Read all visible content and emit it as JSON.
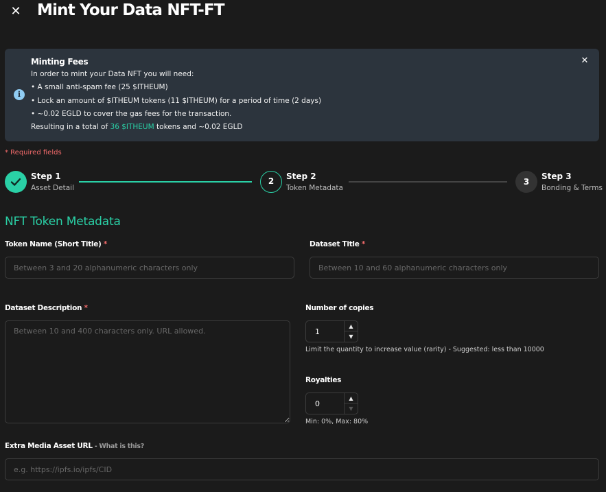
{
  "header": {
    "close_icon": "close-icon",
    "title": "Mint Your Data NFT-FT"
  },
  "alert": {
    "title": "Minting Fees",
    "lines": [
      "In order to mint your Data NFT you will need:",
      "• A small anti-spam fee (25 $ITHEUM)",
      "• Lock an amount of $ITHEUM tokens (11 $ITHEUM) for a period of time (2 days)",
      "• ~0.02 EGLD to cover the gas fees for the transaction."
    ],
    "total_prefix": "Resulting in a total of ",
    "total_amount": "36 $ITHEUM",
    "total_suffix": " tokens and ~0.02 EGLD",
    "info_icon": "info-icon",
    "close_icon": "close-icon"
  },
  "required_note": "*  Required fields",
  "stepper": {
    "steps": [
      {
        "number": "1",
        "title": "Step 1",
        "subtitle": "Asset Detail",
        "state": "complete"
      },
      {
        "number": "2",
        "title": "Step 2",
        "subtitle": "Token Metadata",
        "state": "active"
      },
      {
        "number": "3",
        "title": "Step 3",
        "subtitle": "Bonding & Terms",
        "state": "pending"
      }
    ]
  },
  "section_title": "NFT Token Metadata",
  "form": {
    "token_name": {
      "label": "Token Name (Short Title)",
      "required": "*",
      "placeholder": "Between 3 and 20 alphanumeric characters only",
      "value": ""
    },
    "dataset_title": {
      "label": "Dataset Title",
      "required": "*",
      "placeholder": "Between 10 and 60 alphanumeric characters only",
      "value": ""
    },
    "dataset_description": {
      "label": "Dataset Description",
      "required": "*",
      "placeholder": "Between 10 and 400 characters only. URL allowed.",
      "value": ""
    },
    "copies": {
      "label": "Number of copies",
      "value": "1",
      "help": "Limit the quantity to increase value (rarity) - Suggested: less than 10000"
    },
    "royalties": {
      "label": "Royalties",
      "value": "0",
      "help": "Min: 0%, Max: 80%"
    },
    "extra_media": {
      "label": "Extra Media Asset URL",
      "hint": " - What is this?",
      "placeholder": "e.g. https://ipfs.io/ipfs/CID",
      "value": ""
    }
  },
  "colors": {
    "accent": "#2ad0a6",
    "required": "#f56c6c",
    "alert_bg": "#2c343d",
    "info": "#90cdf4"
  }
}
